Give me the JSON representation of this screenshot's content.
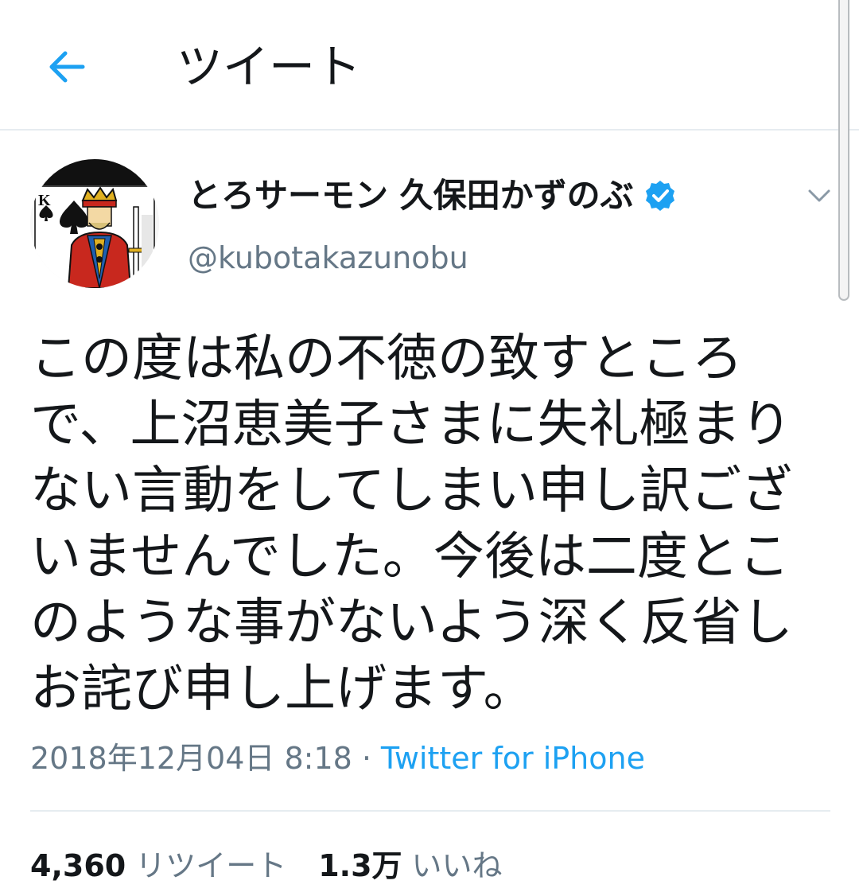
{
  "header": {
    "title": "ツイート",
    "back_icon": "arrow-left-icon"
  },
  "user": {
    "display_name": "とろサーモン 久保田かずのぶ",
    "handle": "@kubotakazunobu",
    "verified": true,
    "avatar_icon": "king-of-spades-card-icon"
  },
  "tweet": {
    "lines": [
      "この度は私の不徳の致すところ",
      "で、上沼恵美子さまに失礼極まり",
      "ない言動をしてしまい申し訳ござ",
      "いませんでした。今後は二度とこ",
      "のような事がないよう深く反省し",
      "お詫び申し上げます。"
    ],
    "timestamp": "2018年12月04日 8:18",
    "separator": "·",
    "source": "Twitter for iPhone"
  },
  "stats": {
    "retweets_count": "4,360",
    "retweets_label": "リツイート",
    "likes_count": "1.3万",
    "likes_label": "いいね"
  },
  "colors": {
    "accent": "#1da1f2",
    "text": "#14171a",
    "secondary_text": "#657786",
    "divider": "#e6ecf0"
  }
}
